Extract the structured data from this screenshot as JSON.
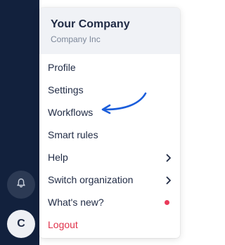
{
  "sidebar": {
    "avatar_initial": "C"
  },
  "menu": {
    "company_name": "Your Company",
    "company_subtitle": "Company Inc",
    "items": [
      {
        "label": "Profile"
      },
      {
        "label": "Settings"
      },
      {
        "label": "Workflows"
      },
      {
        "label": "Smart rules"
      },
      {
        "label": "Help",
        "has_submenu": true
      },
      {
        "label": "Switch organization",
        "has_submenu": true
      },
      {
        "label": "What's new?",
        "notification_dot": true
      },
      {
        "label": "Logout"
      }
    ]
  },
  "annotation": {
    "type": "arrow",
    "points_to": "Workflows",
    "color": "#1a5ddb"
  },
  "colors": {
    "sidebar_bg": "#12213d",
    "logout_text": "#e0324a",
    "notification_dot": "#ea3b5a"
  }
}
